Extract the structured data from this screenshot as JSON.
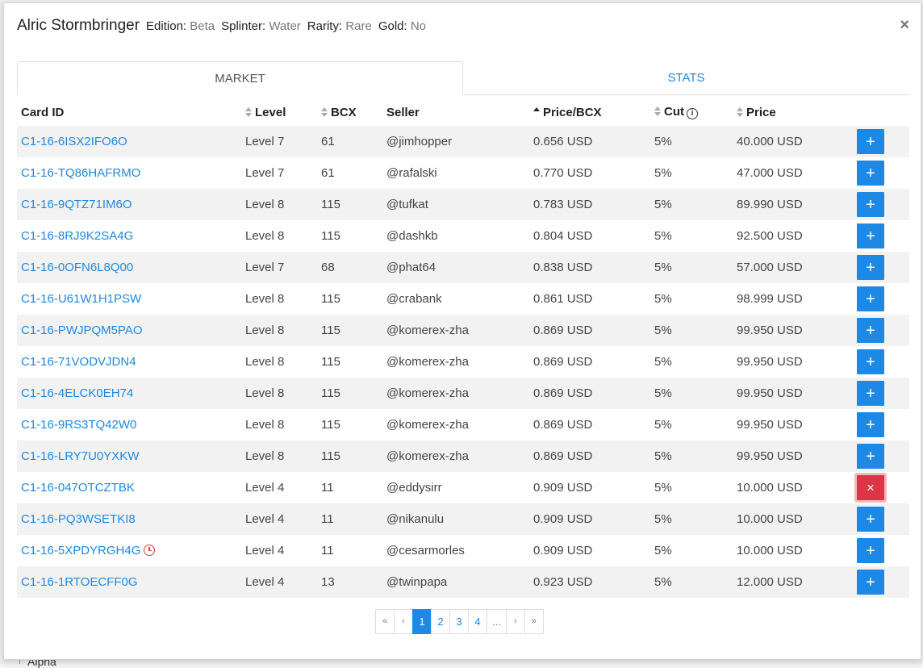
{
  "header": {
    "title": "Alric Stormbringer",
    "edition_label": "Edition:",
    "edition_value": "Beta",
    "splinter_label": "Splinter:",
    "splinter_value": "Water",
    "rarity_label": "Rarity:",
    "rarity_value": "Rare",
    "gold_label": "Gold:",
    "gold_value": "No",
    "close": "×"
  },
  "tabs": [
    {
      "label": "MARKET",
      "active": true
    },
    {
      "label": "STATS",
      "active": false
    }
  ],
  "columns": {
    "card_id": "Card ID",
    "level": "Level",
    "bcx": "BCX",
    "seller": "Seller",
    "price_bcx": "Price/BCX",
    "cut": "Cut",
    "price": "Price"
  },
  "rows": [
    {
      "id": "C1-16-6ISX2IFO6O",
      "level": "Level 7",
      "bcx": "61",
      "seller": "@jimhopper",
      "price_bcx": "0.656 USD",
      "cut": "5%",
      "price": "40.000 USD",
      "action": "+",
      "state": "add"
    },
    {
      "id": "C1-16-TQ86HAFRMO",
      "level": "Level 7",
      "bcx": "61",
      "seller": "@rafalski",
      "price_bcx": "0.770 USD",
      "cut": "5%",
      "price": "47.000 USD",
      "action": "+",
      "state": "add"
    },
    {
      "id": "C1-16-9QTZ71IM6O",
      "level": "Level 8",
      "bcx": "115",
      "seller": "@tufkat",
      "price_bcx": "0.783 USD",
      "cut": "5%",
      "price": "89.990 USD",
      "action": "+",
      "state": "add"
    },
    {
      "id": "C1-16-8RJ9K2SA4G",
      "level": "Level 8",
      "bcx": "115",
      "seller": "@dashkb",
      "price_bcx": "0.804 USD",
      "cut": "5%",
      "price": "92.500 USD",
      "action": "+",
      "state": "add"
    },
    {
      "id": "C1-16-0OFN6L8Q00",
      "level": "Level 7",
      "bcx": "68",
      "seller": "@phat64",
      "price_bcx": "0.838 USD",
      "cut": "5%",
      "price": "57.000 USD",
      "action": "+",
      "state": "add"
    },
    {
      "id": "C1-16-U61W1H1PSW",
      "level": "Level 8",
      "bcx": "115",
      "seller": "@crabank",
      "price_bcx": "0.861 USD",
      "cut": "5%",
      "price": "98.999 USD",
      "action": "+",
      "state": "add"
    },
    {
      "id": "C1-16-PWJPQM5PAO",
      "level": "Level 8",
      "bcx": "115",
      "seller": "@komerex-zha",
      "price_bcx": "0.869 USD",
      "cut": "5%",
      "price": "99.950 USD",
      "action": "+",
      "state": "add"
    },
    {
      "id": "C1-16-71VODVJDN4",
      "level": "Level 8",
      "bcx": "115",
      "seller": "@komerex-zha",
      "price_bcx": "0.869 USD",
      "cut": "5%",
      "price": "99.950 USD",
      "action": "+",
      "state": "add"
    },
    {
      "id": "C1-16-4ELCK0EH74",
      "level": "Level 8",
      "bcx": "115",
      "seller": "@komerex-zha",
      "price_bcx": "0.869 USD",
      "cut": "5%",
      "price": "99.950 USD",
      "action": "+",
      "state": "add"
    },
    {
      "id": "C1-16-9RS3TQ42W0",
      "level": "Level 8",
      "bcx": "115",
      "seller": "@komerex-zha",
      "price_bcx": "0.869 USD",
      "cut": "5%",
      "price": "99.950 USD",
      "action": "+",
      "state": "add"
    },
    {
      "id": "C1-16-LRY7U0YXKW",
      "level": "Level 8",
      "bcx": "115",
      "seller": "@komerex-zha",
      "price_bcx": "0.869 USD",
      "cut": "5%",
      "price": "99.950 USD",
      "action": "+",
      "state": "add"
    },
    {
      "id": "C1-16-047OTCZTBK",
      "level": "Level 4",
      "bcx": "11",
      "seller": "@eddysirr",
      "price_bcx": "0.909 USD",
      "cut": "5%",
      "price": "10.000 USD",
      "action": "×",
      "state": "remove"
    },
    {
      "id": "C1-16-PQ3WSETKI8",
      "level": "Level 4",
      "bcx": "11",
      "seller": "@nikanulu",
      "price_bcx": "0.909 USD",
      "cut": "5%",
      "price": "10.000 USD",
      "action": "+",
      "state": "add"
    },
    {
      "id": "C1-16-5XPDYRGH4G",
      "level": "Level 4",
      "bcx": "11",
      "seller": "@cesarmorles",
      "price_bcx": "0.909 USD",
      "cut": "5%",
      "price": "10.000 USD",
      "action": "+",
      "state": "add",
      "clock": true
    },
    {
      "id": "C1-16-1RTOECFF0G",
      "level": "Level 4",
      "bcx": "13",
      "seller": "@twinpapa",
      "price_bcx": "0.923 USD",
      "cut": "5%",
      "price": "12.000 USD",
      "action": "+",
      "state": "add"
    }
  ],
  "pagination": {
    "first": "«",
    "prev": "‹",
    "pages": [
      "1",
      "2",
      "3",
      "4"
    ],
    "active": "1",
    "ellipsis": "...",
    "next": "›",
    "last": "»"
  },
  "background": {
    "text": "Alpha"
  },
  "colors": {
    "link": "#1e88e5",
    "add_button": "#1e88e5",
    "remove_button": "#dc3545",
    "clock_icon": "#e53935"
  }
}
